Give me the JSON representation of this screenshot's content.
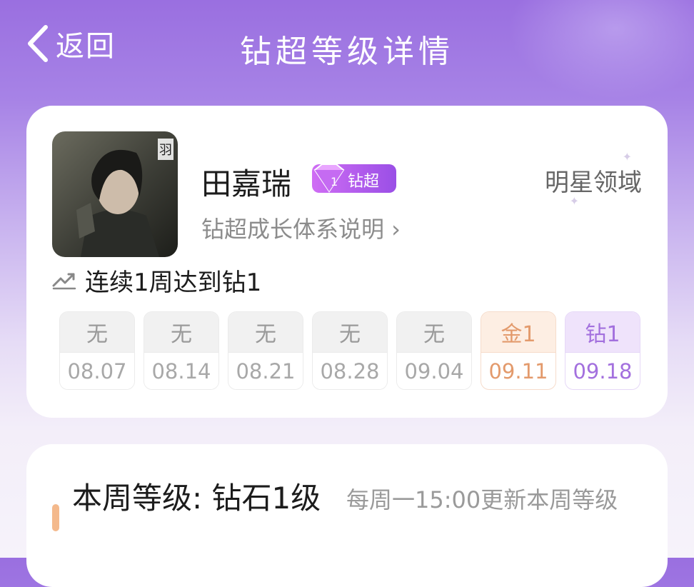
{
  "header": {
    "back_label": "返回",
    "title": "钻超等级详情"
  },
  "profile": {
    "name": "田嘉瑞",
    "badge_label": "钻超",
    "realm": "明星领域",
    "growth_link": "钻超成长体系说明 ›",
    "streak_text": "连续1周达到钻1",
    "avatar_glyph": "羽"
  },
  "weeks": [
    {
      "level": "无",
      "date": "08.07",
      "kind": "none"
    },
    {
      "level": "无",
      "date": "08.14",
      "kind": "none"
    },
    {
      "level": "无",
      "date": "08.21",
      "kind": "none"
    },
    {
      "level": "无",
      "date": "08.28",
      "kind": "none"
    },
    {
      "level": "无",
      "date": "09.04",
      "kind": "none"
    },
    {
      "level": "金1",
      "date": "09.11",
      "kind": "gold"
    },
    {
      "level": "钻1",
      "date": "09.18",
      "kind": "diamond"
    }
  ],
  "current": {
    "level_text": "本周等级: 钻石1级",
    "update_text": "每周一15:00更新本周等级"
  },
  "colors": {
    "accent": "#a370de",
    "gold": "#e39a6c",
    "badge": "#b55fee",
    "marker": "#f4b98c"
  }
}
